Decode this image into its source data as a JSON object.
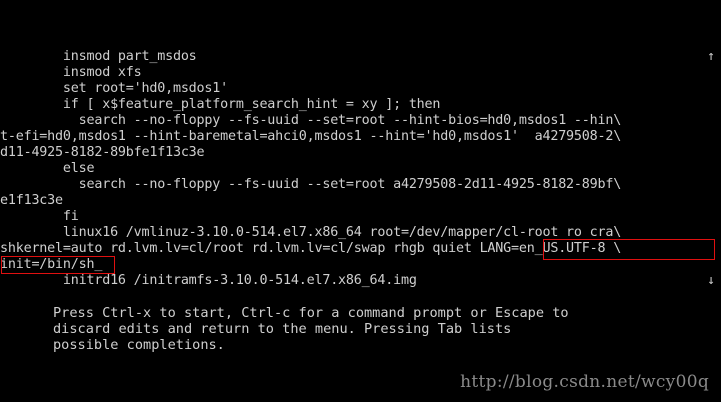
{
  "editor": {
    "lines": [
      "        insmod part_msdos",
      "        insmod xfs",
      "        set root='hd0,msdos1'",
      "        if [ x$feature_platform_search_hint = xy ]; then",
      "          search --no-floppy --fs-uuid --set=root --hint-bios=hd0,msdos1 --hin\\",
      "t-efi=hd0,msdos1 --hint-baremetal=ahci0,msdos1 --hint='hd0,msdos1'  a4279508-2\\",
      "d11-4925-8182-89bfe1f13c3e",
      "        else",
      "          search --no-floppy --fs-uuid --set=root a4279508-2d11-4925-8182-89bf\\",
      "e1f13c3e",
      "        fi",
      "        linux16 /vmlinuz-3.10.0-514.el7.x86_64 root=/dev/mapper/cl-root ro cra\\",
      "shkernel=auto rd.lvm.lv=cl/root rd.lvm.lv=cl/swap rhgb quiet LANG=en_US.UTF-8 \\",
      "init=/bin/sh_",
      "        initrd16 /initramfs-3.10.0-514.el7.x86_64.img"
    ],
    "scroll_up_icon": "↑",
    "scroll_down_icon": "↓",
    "highlight_color": "#e01010"
  },
  "help": {
    "lines": [
      "Press Ctrl-x to start, Ctrl-c for a command prompt or Escape to",
      "discard edits and return to the menu. Pressing Tab lists",
      "possible completions."
    ]
  },
  "watermark": "http://blog.csdn.net/wcy00q"
}
